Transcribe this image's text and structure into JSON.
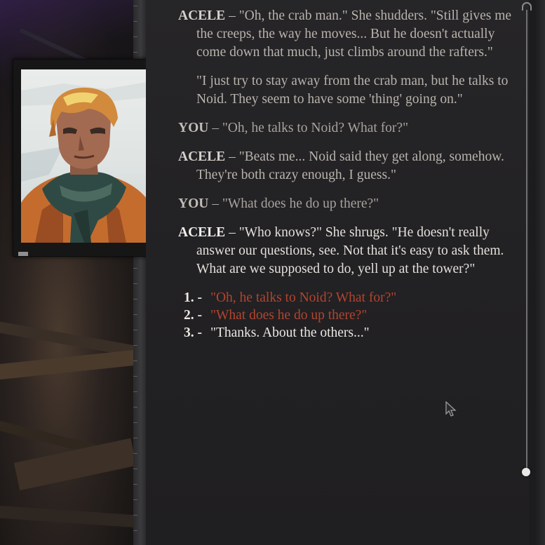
{
  "portrait": {
    "character": "ACELE",
    "icon": "character-portrait"
  },
  "dialogue": {
    "entries": [
      {
        "speaker": "ACELE",
        "sep": " – ",
        "text": "\"Oh, the crab man.\" She shudders. \"Still gives me the creeps, the way he moves... But he doesn't actually come down that much, just climbs around the rafters.\""
      },
      {
        "speaker": "",
        "sep": "",
        "text": "\"I just try to stay away from the crab man, but he talks to Noid. They seem to have some 'thing' going on.\""
      },
      {
        "speaker": "YOU",
        "sep": " – ",
        "text": "\"Oh, he talks to Noid? What for?\""
      },
      {
        "speaker": "ACELE",
        "sep": " – ",
        "text": "\"Beats me... Noid said they get along, somehow. They're both crazy enough, I guess.\""
      },
      {
        "speaker": "YOU",
        "sep": " – ",
        "text": "\"What does he do up there?\""
      },
      {
        "speaker": "ACELE",
        "sep": " – ",
        "text": "\"Who knows?\" She shrugs. \"He doesn't really answer our questions, see. Not that it's easy to ask them. What are we supposed to do, yell up at the tower?\""
      }
    ],
    "options": [
      {
        "num": "1. -",
        "text": "\"Oh, he talks to Noid? What for?\"",
        "state": "seen"
      },
      {
        "num": "2. -",
        "text": "\"What does he do up there?\"",
        "state": "seen"
      },
      {
        "num": "3. -",
        "text": "\"Thanks. About the others...\"",
        "state": "new"
      }
    ]
  },
  "colors": {
    "seen_option": "#b2452f",
    "new_option": "#ece8e4",
    "panel_bg": "#242325",
    "text": "#b9b3ad"
  }
}
